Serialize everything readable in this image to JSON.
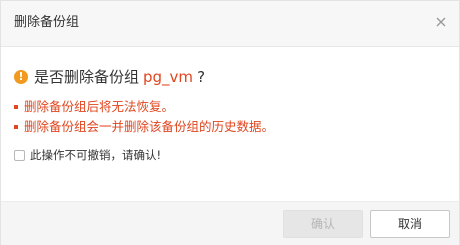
{
  "dialog": {
    "title": "删除备份组",
    "close_icon": "close-icon"
  },
  "question": {
    "icon": "exclamation-circle-icon",
    "prefix": "是否删除备份组",
    "name": "pg_vm",
    "suffix": "?"
  },
  "warnings": [
    "删除备份组后将无法恢复。",
    "删除备份组会一并删除该备份组的历史数据。"
  ],
  "confirm": {
    "checked": false,
    "label": "此操作不可撤销，请确认!"
  },
  "buttons": {
    "confirm_label": "确认",
    "confirm_disabled": true,
    "cancel_label": "取消"
  },
  "colors": {
    "warning_text": "#e0461f",
    "warning_icon": "#f29a1f",
    "disabled_button": "#e6e6e6"
  }
}
